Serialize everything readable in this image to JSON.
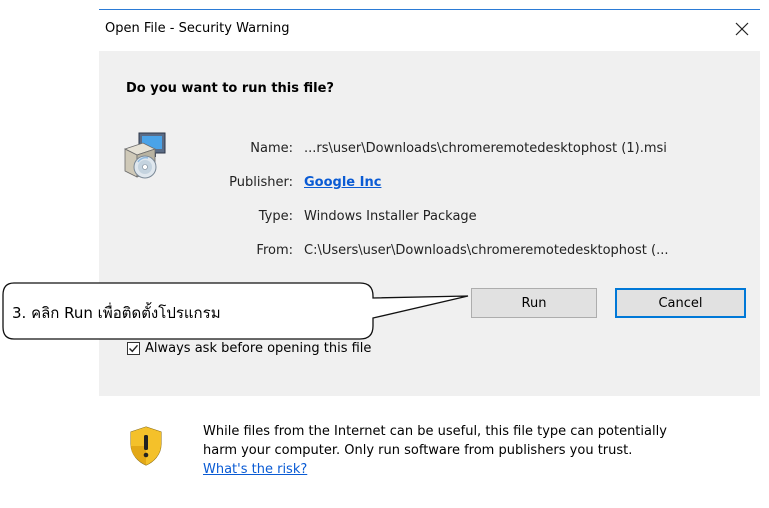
{
  "window": {
    "title": "Open File - Security Warning",
    "close_glyph": "✕"
  },
  "prompt": {
    "question": "Do you want to run this file?"
  },
  "file_info": {
    "name_label": "Name:",
    "name_value": "...rs\\user\\Downloads\\chromeremotedesktophost (1).msi",
    "publisher_label": "Publisher:",
    "publisher_value": "Google Inc",
    "type_label": "Type:",
    "type_value": "Windows Installer Package",
    "from_label": "From:",
    "from_value": "C:\\Users\\user\\Downloads\\chromeremotedesktophost (..."
  },
  "buttons": {
    "run_label": "Run",
    "cancel_label": "Cancel"
  },
  "options": {
    "always_ask_label": "Always ask before opening this file",
    "always_ask_checked": true
  },
  "warning": {
    "line1": "While files from the Internet can be useful, this file type can potentially",
    "line2": "harm your computer. Only run software from publishers you trust.",
    "risk_link": "What's the risk?"
  },
  "annotation": {
    "callout_text": "3. คลิก Run เพื่อติดตั้งโปรแกรม"
  },
  "icons": {
    "package": "installer-package-icon",
    "shield": "security-shield-icon",
    "check": "checkmark-icon",
    "close": "close-icon"
  },
  "colors": {
    "accent": "#0078d7",
    "link": "#0a5bd4",
    "panel_bg": "#f0f0f0"
  }
}
